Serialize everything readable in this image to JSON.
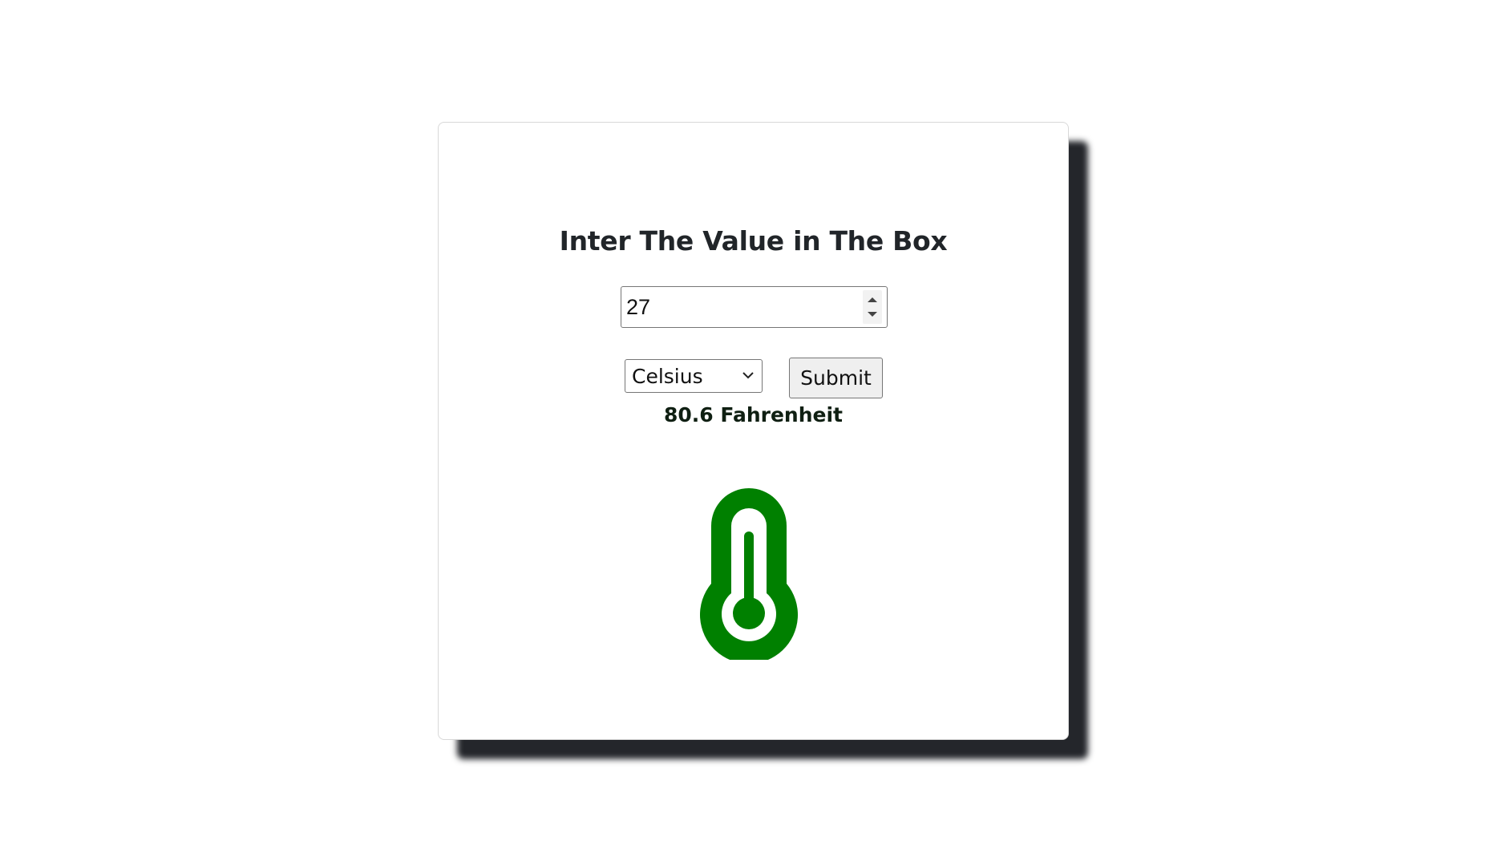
{
  "form": {
    "title": "Inter The Value in The Box",
    "input_value": "27",
    "unit_selected": "Celsius",
    "submit_label": "Submit"
  },
  "result": {
    "text": "80.6 Fahrenheit"
  },
  "icons": {
    "thermometer": "thermometer-icon",
    "spinner": "number-spinner-icon",
    "dropdown": "chevron-down-icon"
  },
  "colors": {
    "thermometer": "#008000",
    "card_shadow": "#24262b",
    "title_text": "#212529"
  }
}
